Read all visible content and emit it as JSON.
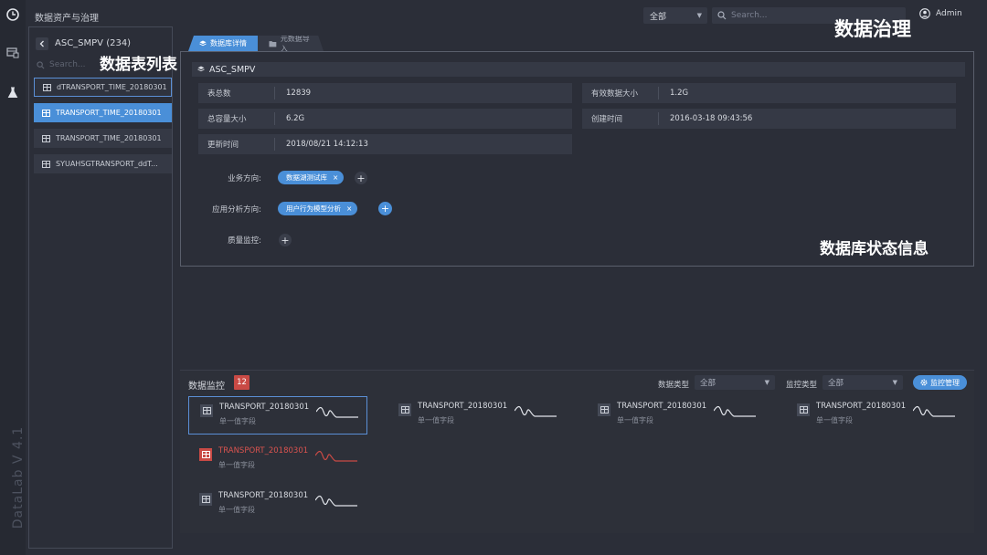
{
  "app": {
    "title": "数据资产与治理",
    "version": "DataLab V 4.1"
  },
  "rail": {
    "logo_icon": "clock-logo-icon",
    "items": [
      "database-icon",
      "flask-icon"
    ]
  },
  "topbar": {
    "scope_value": "全部",
    "search_placeholder": "Search...",
    "user": "Admin"
  },
  "overlays": {
    "governance": "数据治理",
    "table_list": "数据表列表",
    "status_info": "数据库状态信息"
  },
  "left_panel": {
    "db_name": "ASC_SMPV (234)",
    "search_placeholder": "Search...",
    "tables": [
      {
        "name": "dTRANSPORT_TIME_20180301",
        "state": "outlined"
      },
      {
        "name": "TRANSPORT_TIME_20180301",
        "state": "selected"
      },
      {
        "name": "TRANSPORT_TIME_20180301",
        "state": "normal"
      },
      {
        "name": "SYUAHSGTRANSPORT_ddT...",
        "state": "normal"
      }
    ]
  },
  "tabs": [
    {
      "label": "数据库详情",
      "active": true
    },
    {
      "label": "元数据导入",
      "active": false
    }
  ],
  "details": {
    "header": "ASC_SMPV",
    "rows": [
      {
        "label": "表总数",
        "value": "12839"
      },
      {
        "label": "有效数据大小",
        "value": "1.2G"
      },
      {
        "label": "总容量大小",
        "value": "6.2G"
      },
      {
        "label": "创建时间",
        "value": "2016-03-18 09:43:56"
      },
      {
        "label": "更新时间",
        "value": "2018/08/21 14:12:13"
      }
    ],
    "business_label": "业务方向:",
    "business_tag": "数据湖测试库",
    "analysis_label": "应用分析方向:",
    "analysis_tag": "用户行为模型分析",
    "quality_label": "质量监控:",
    "tag_remove": "×",
    "add": "+"
  },
  "monitor": {
    "title": "数据监控",
    "count": "12",
    "data_type_label": "数据类型",
    "data_type_value": "全部",
    "monitor_type_label": "监控类型",
    "monitor_type_value": "全部",
    "manage_button": "监控管理",
    "accent": "#4a8fd8",
    "alert_color": "#c94a45",
    "cards": [
      {
        "name": "TRANSPORT_20180301",
        "sub": "单一值字段",
        "state": "highlight"
      },
      {
        "name": "TRANSPORT_20180301",
        "sub": "单一值字段",
        "state": "normal"
      },
      {
        "name": "TRANSPORT_20180301",
        "sub": "单一值字段",
        "state": "normal"
      },
      {
        "name": "TRANSPORT_20180301",
        "sub": "单一值字段",
        "state": "normal"
      },
      {
        "name": "TRANSPORT_20180301",
        "sub": "单一值字段",
        "state": "alert"
      },
      {
        "name": "TRANSPORT_20180301",
        "sub": "单一值字段",
        "state": "normal"
      }
    ]
  }
}
